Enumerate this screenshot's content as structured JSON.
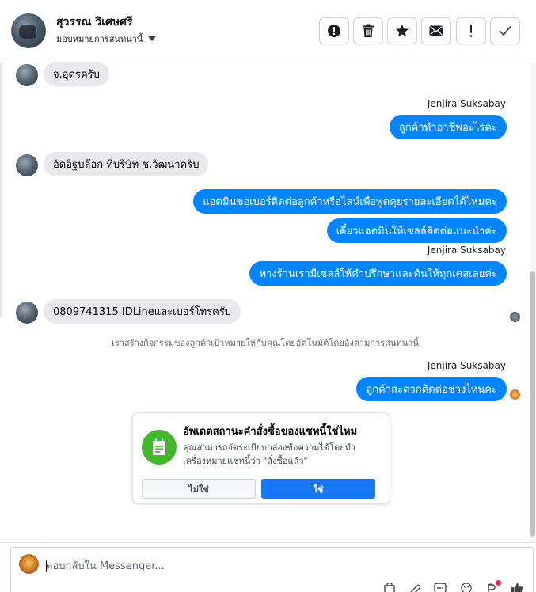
{
  "header": {
    "contact_name": "สุวรรณ วิเศษศรี",
    "assign_label": "มอบหมายการสนทนานี้",
    "buttons": [
      {
        "name": "alert-button",
        "icon": "exclamation-circle-icon"
      },
      {
        "name": "delete-button",
        "icon": "trash-icon"
      },
      {
        "name": "star-button",
        "icon": "star-icon"
      },
      {
        "name": "mark-unread-button",
        "icon": "envelope-icon"
      },
      {
        "name": "spam-button",
        "icon": "exclamation-icon"
      },
      {
        "name": "done-button",
        "icon": "checkmark-icon"
      }
    ]
  },
  "messages": {
    "in_1": "จ.อุดรครับ",
    "sender_1": "Jenjira Suksabay",
    "out_1": "ลูกค้าทำอาชีพอะไรคะ",
    "in_2": "อัดอิฐบล้อก ที่บริษัท ช.วัฒนาครับ",
    "out_2": "แอดมินขอเบอร์ติดต่อลูกค้าหรือไลน์เพื่อพูดคุยรายละเอียดได้ไหมคะ",
    "out_3": "เดี๋ยวแอดมินให้เซลล์ติดต่อแนะนำค่ะ",
    "sender_2": "Jenjira Suksabay",
    "out_4": "ทางร้านเรามีเซลล์ให้คำปรึกษาและดันให้ทุกเคสเลยค่ะ",
    "in_3": "0809741315 IDLineและเบอร์โทรครับ",
    "system_note": "เราสร้างกิจกรรมของลูกค้าเป้าหมายให้กับคุณโดยอัตโนมัติโดยอิงตามการสนทนานี้",
    "sender_3": "Jenjira Suksabay",
    "out_5": "ลูกค้าสะดวกติดต่อช่วงไหนคะ"
  },
  "card": {
    "title": "อัพเดตสถานะคำสั่งซื้อของแชทนี้ใช่ไหม",
    "body": "คุณสามารถจัดระเบียบกล่องข้อความได้โดยทำเครื่องหมายแชทนี้ว่า \"สั่งซื้อแล้ว\"",
    "no_label": "ไม่ใช่",
    "yes_label": "ใช่",
    "icon": "order-receipt-icon"
  },
  "composer": {
    "placeholder": "ตอบกลับใน Messenger...",
    "tools": [
      "bag-icon",
      "paperclip-icon",
      "saved-reply-icon",
      "emoji-icon",
      "mention-icon",
      "thumbs-up-icon"
    ]
  },
  "colors": {
    "outgoing_bubble": "#0084ff",
    "incoming_bubble": "#e9e9eb",
    "card_icon": "#42b72a",
    "primary_button": "#1877f2"
  }
}
